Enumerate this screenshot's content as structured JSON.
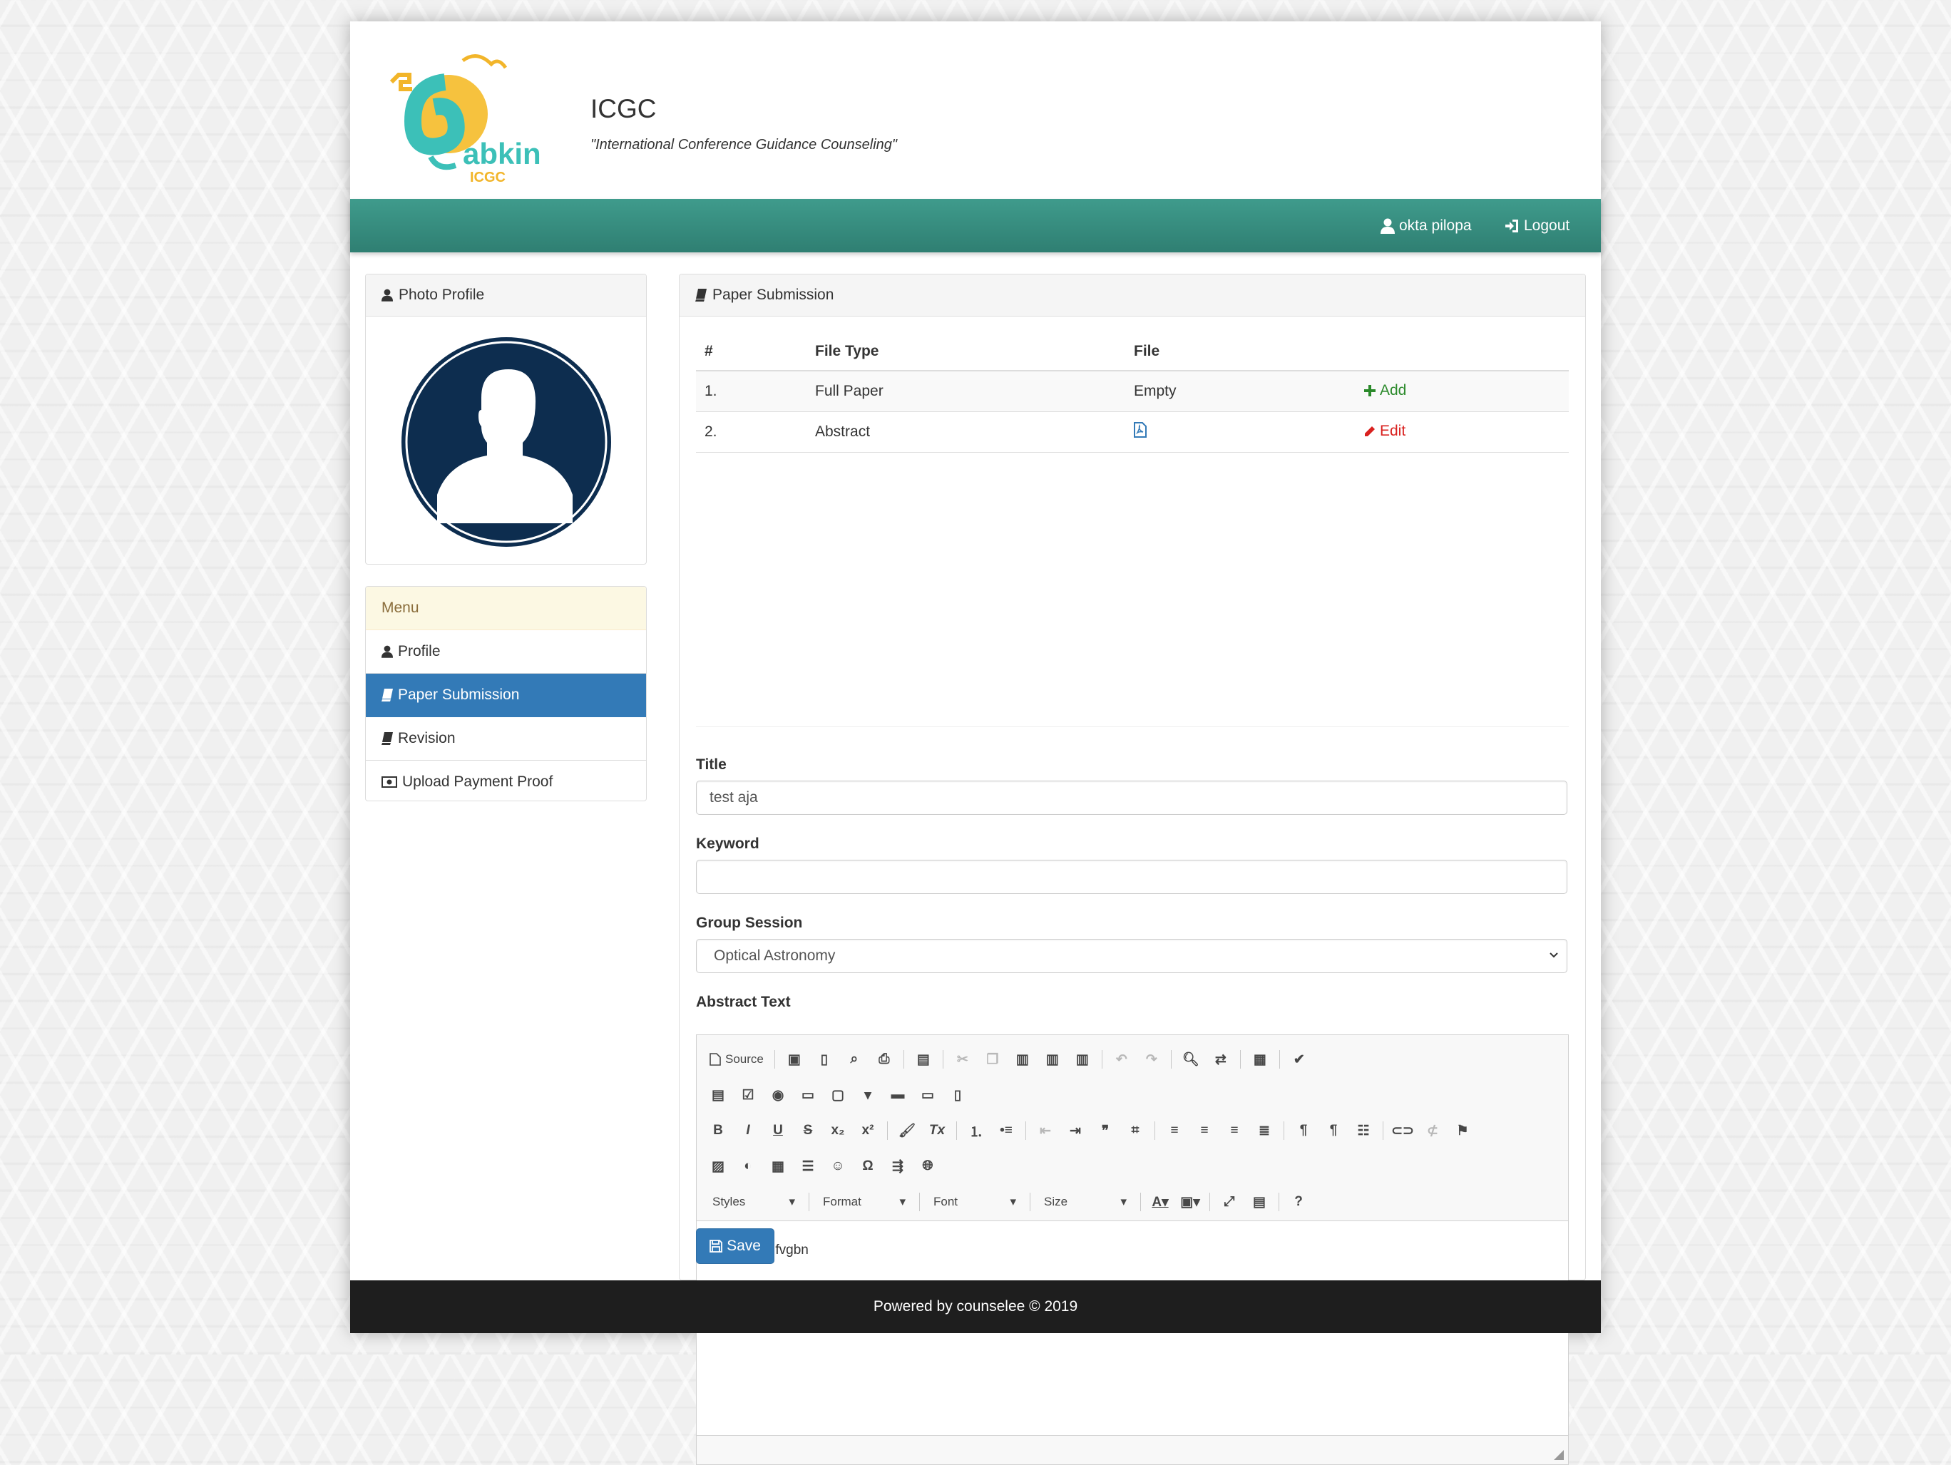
{
  "header": {
    "title": "ICGC",
    "subtitle": "\"International Conference Guidance Counseling\"",
    "logo_text": "abkin",
    "logo_sub": "ICGC"
  },
  "navbar": {
    "user": "okta pilopa",
    "logout": "Logout"
  },
  "photo_panel": {
    "title": "Photo Profile"
  },
  "menu": {
    "heading": "Menu",
    "items": [
      {
        "label": "Profile"
      },
      {
        "label": "Paper Submission"
      },
      {
        "label": "Revision"
      },
      {
        "label": "Upload Payment Proof"
      }
    ]
  },
  "submission": {
    "title": "Paper Submission",
    "columns": [
      "#",
      "File Type",
      "File"
    ],
    "rows": [
      {
        "num": "1.",
        "type": "Full Paper",
        "file": "Empty",
        "action": "Add"
      },
      {
        "num": "2.",
        "type": "Abstract",
        "file": "",
        "action": "Edit"
      }
    ],
    "title_label": "Title",
    "title_value": "test aja",
    "keyword_label": "Keyword",
    "keyword_value": "",
    "group_label": "Group Session",
    "group_value": "Optical Astronomy",
    "abstract_label": "Abstract Text",
    "abstract_value": "xdvfgbhn fvgbn",
    "save": "Save"
  },
  "editor_toolbar": {
    "source": "Source",
    "styles": "Styles",
    "format": "Format",
    "font": "Font",
    "size": "Size"
  },
  "footer": {
    "text": "Powered by counselee © 2019"
  },
  "colors": {
    "navbar": "#3b9688",
    "primary": "#337ab7",
    "add": "#2b8a2b",
    "edit": "#d9211f",
    "menu_heading_bg": "#fcf8e3",
    "avatar": "#0d2d4f"
  }
}
